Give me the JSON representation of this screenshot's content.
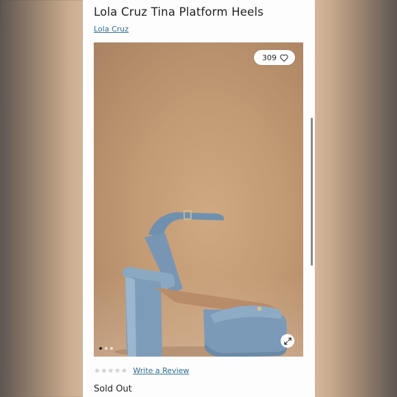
{
  "product": {
    "title": "Lola Cruz Tina Platform Heels",
    "brand": "Lola Cruz",
    "like_count": "309",
    "rating_stars": 0,
    "rating_max": 5,
    "review_link": "Write a Review",
    "stock_status": "Sold Out"
  },
  "carousel": {
    "total_images": 3,
    "active_index": 0
  },
  "colors": {
    "link": "#2f6d8f",
    "shoe": "#7f9db9",
    "background_image": "#c29a74"
  },
  "icons": {
    "like": "heart-icon",
    "expand": "expand-icon",
    "rating": "star-icon"
  }
}
